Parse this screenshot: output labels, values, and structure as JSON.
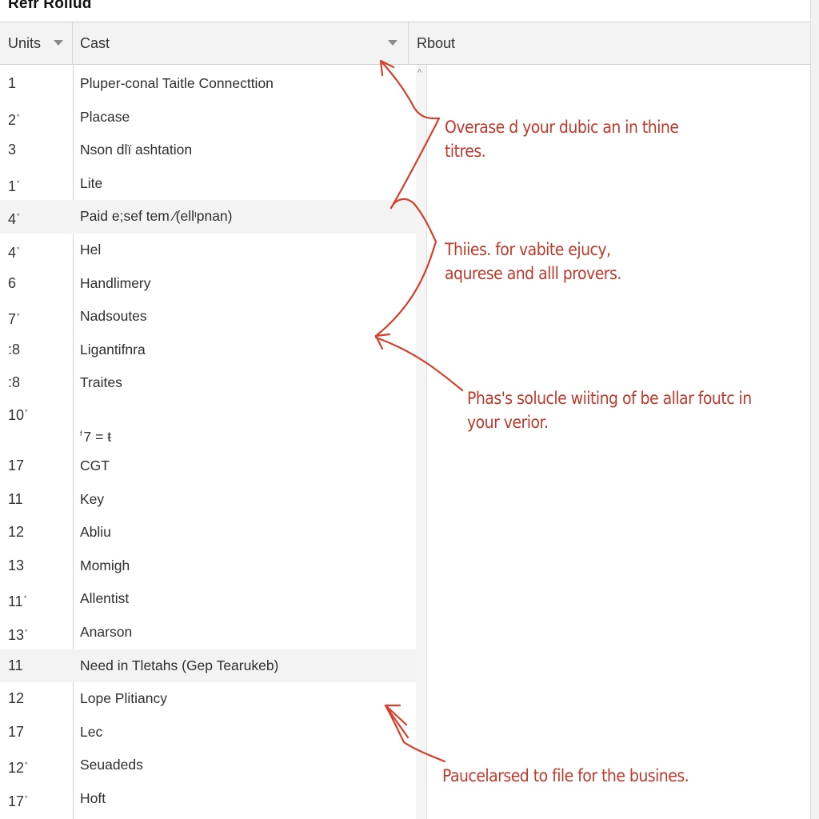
{
  "app": {
    "title": "Refr Rollud"
  },
  "table": {
    "columns": [
      {
        "label": "Units",
        "sortable": true
      },
      {
        "label": "Cast",
        "sortable": true
      },
      {
        "label": "Rbout",
        "sortable": false
      }
    ],
    "rows": [
      {
        "units": "1",
        "units_mark": "",
        "cast": "Pluper-conal Taitle Connecttion",
        "highlighted": false
      },
      {
        "units": "2",
        "units_mark": "*",
        "cast": "Placase",
        "highlighted": false
      },
      {
        "units": "3",
        "units_mark": "",
        "cast": "Nson dlï ashtation",
        "highlighted": false
      },
      {
        "units": "1",
        "units_mark": "*",
        "cast": "Lite",
        "highlighted": false
      },
      {
        "units": "4",
        "units_mark": "*",
        "cast": "Paid e;sef tem ⁄(ellᶦpnan)",
        "highlighted": true
      },
      {
        "units": "4",
        "units_mark": "*",
        "cast": "Hel",
        "highlighted": false
      },
      {
        "units": "6",
        "units_mark": "",
        "cast": "Handlimery",
        "highlighted": false
      },
      {
        "units": "7",
        "units_mark": "*",
        "cast": "Nadsoutes",
        "highlighted": false
      },
      {
        "units": ":8",
        "units_mark": "",
        "cast": "Ligantifnra",
        "highlighted": false
      },
      {
        "units": ":8",
        "units_mark": "",
        "cast": "Traites",
        "highlighted": false
      },
      {
        "units": "10",
        "units_mark": "*",
        "cast": "7 = ŧ",
        "cast_mark": "f",
        "highlighted": false,
        "tall": true
      },
      {
        "units": "17",
        "units_mark": "",
        "cast": "CGT",
        "highlighted": false
      },
      {
        "units": "11",
        "units_mark": "",
        "cast": "Key",
        "highlighted": false
      },
      {
        "units": "12",
        "units_mark": "",
        "cast": "Abliu",
        "highlighted": false
      },
      {
        "units": "13",
        "units_mark": "",
        "cast": "Momigh",
        "highlighted": false
      },
      {
        "units": "11",
        "units_mark": "*",
        "cast": "Allentist",
        "highlighted": false
      },
      {
        "units": "13",
        "units_mark": "*",
        "cast": "Anarson",
        "highlighted": false
      },
      {
        "units": "11",
        "units_mark": "",
        "cast": "Need in Tletahs (Gep Tearukeb)",
        "highlighted": true
      },
      {
        "units": "12",
        "units_mark": "",
        "cast": "Lope Plitiancy",
        "highlighted": false
      },
      {
        "units": "17",
        "units_mark": "",
        "cast": "Lec",
        "highlighted": false
      },
      {
        "units": "12",
        "units_mark": "*",
        "cast": "Seuadeds",
        "highlighted": false
      },
      {
        "units": "17",
        "units_mark": "*",
        "cast": "Hoft",
        "highlighted": false
      }
    ]
  },
  "scrollbar": {
    "up_glyph": "^"
  },
  "annotations": [
    {
      "line1": "Overase d your dubic an in thine",
      "line2": "titres."
    },
    {
      "line1": "Thiies. for vabite ejucy,",
      "line2": "aqurese and alll provers."
    },
    {
      "line1": "Phas's solucle wiiting of be allar foutc in",
      "line2": "your verior."
    },
    {
      "line1": "Paucelarsed to file for the busines.",
      "line2": ""
    }
  ],
  "colors": {
    "annotation": "#c0392b",
    "header_bg": "#f3f3f3",
    "highlight_row": "#f3f3f3"
  }
}
